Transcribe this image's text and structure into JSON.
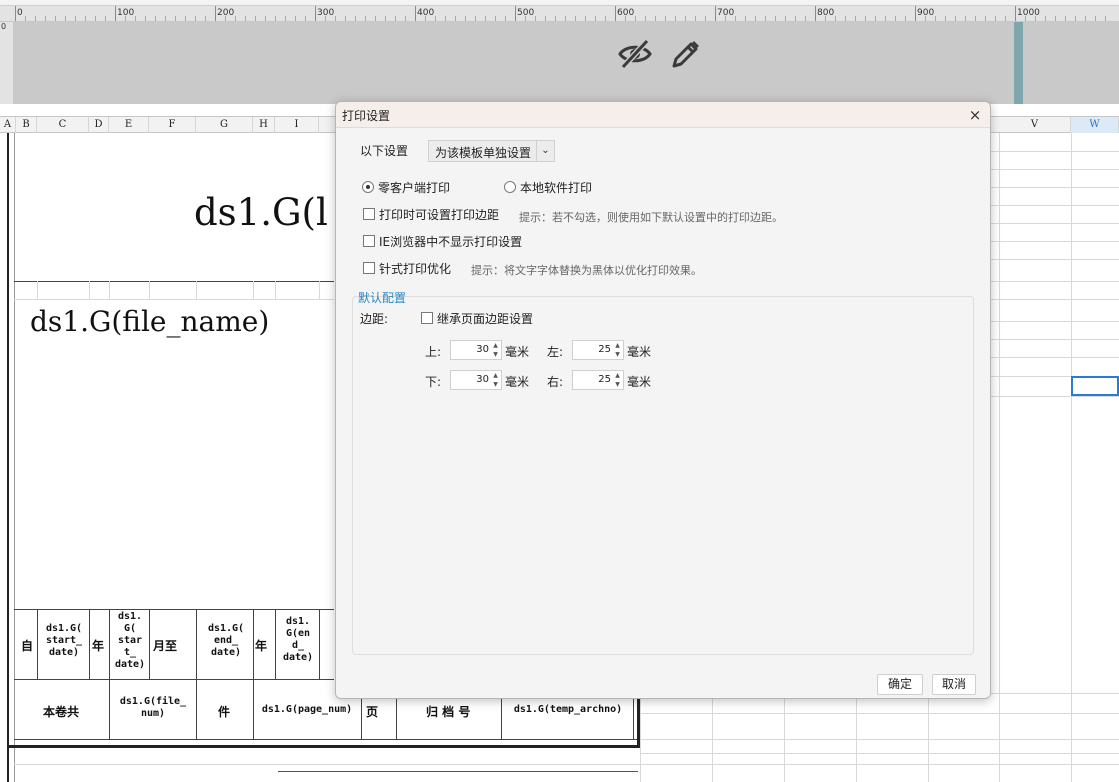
{
  "ruler": {
    "labels": [
      "0",
      "100",
      "200",
      "300",
      "400",
      "500",
      "600",
      "700",
      "800",
      "900",
      "1000"
    ],
    "vlabel": "0"
  },
  "toolbar_icons": {
    "hide": "eye-slash-icon",
    "edit": "pencil-icon"
  },
  "columns": {
    "left": [
      "A",
      "B",
      "C",
      "D",
      "E",
      "F",
      "G",
      "H",
      "I"
    ],
    "right": [
      "V",
      "W"
    ],
    "selected": "W"
  },
  "sheet": {
    "title_formula": "ds1.G(l",
    "file_name_formula": "ds1.G(file_name)",
    "row1": {
      "zi": "自",
      "start_date": "ds1.G(\nstart_\ndate)",
      "nian1": "年",
      "start_t_date": "ds1.\nG(\nstar\nt_\ndate)",
      "yue_zhi": "月至",
      "end_date": "ds1.G(\nend_\ndate)",
      "nian2": "年",
      "en_d_date": "ds1.\nG(en\nd_\ndate)"
    },
    "row2": {
      "ben_juan_gong": "本卷共",
      "file_num": "ds1.G(file_\nnum)",
      "jian": "件",
      "page_num": "ds1.G(page_num)",
      "ye": "页",
      "gui_dang_hao": "归 档 号",
      "temp_archno": "ds1.G(temp_archno)"
    }
  },
  "dialog": {
    "title": "打印设置",
    "close": "×",
    "settings_label": "以下设置",
    "settings_select": "为该模板单独设置",
    "radio_zero_client": "零客户端打印",
    "radio_local": "本地软件打印",
    "chk_set_margin": "打印时可设置打印边距",
    "hint_margin": "提示：若不勾选，则使用如下默认设置中的打印边距。",
    "chk_ie": "IE浏览器中不显示打印设置",
    "chk_dot_matrix": "针式打印优化",
    "hint_dot_matrix": "提示：将文字字体替换为黑体以优化打印效果。",
    "section_title": "默认配置",
    "margin_label": "边距:",
    "chk_inherit": "继承页面边距设置",
    "top_label": "上:",
    "top_value": "30",
    "left_label": "左:",
    "left_value": "25",
    "bottom_label": "下:",
    "bottom_value": "30",
    "right_label": "右:",
    "right_value": "25",
    "unit": "毫米",
    "ok": "确定",
    "cancel": "取消"
  }
}
